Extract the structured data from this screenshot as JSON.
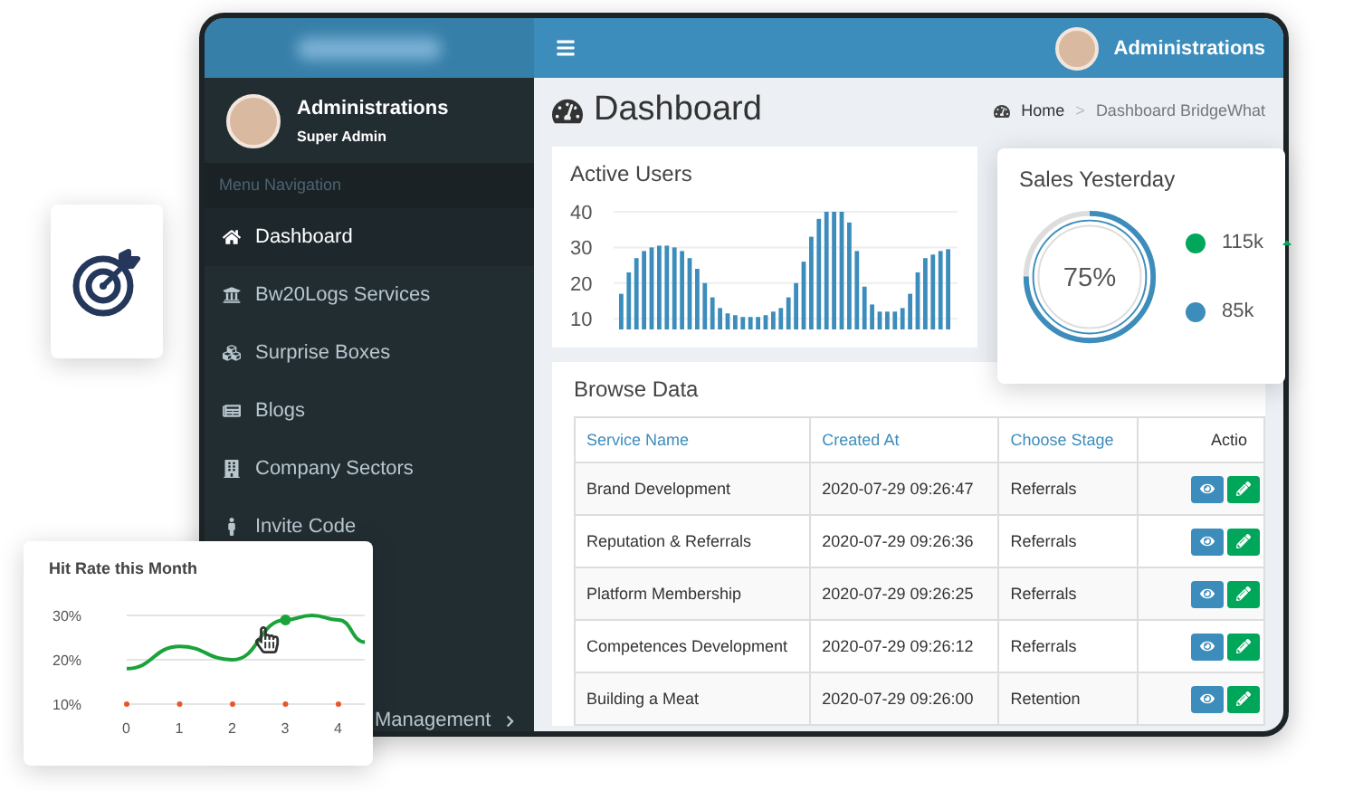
{
  "topbar": {
    "user_name": "Administrations"
  },
  "sidebar": {
    "user": {
      "name": "Administrations",
      "role": "Super Admin"
    },
    "header": "Menu Navigation",
    "items": [
      {
        "label": "Dashboard",
        "selected": true,
        "expandable": false
      },
      {
        "label": "Bw20Logs Services",
        "selected": false,
        "expandable": false
      },
      {
        "label": "Surprise Boxes",
        "selected": false,
        "expandable": false
      },
      {
        "label": "Blogs",
        "selected": false,
        "expandable": false
      },
      {
        "label": "Company Sectors",
        "selected": false,
        "expandable": false
      },
      {
        "label": "Invite Code",
        "selected": false,
        "expandable": false
      },
      {
        "label": "Management",
        "selected": false,
        "expandable": true
      }
    ]
  },
  "page": {
    "title": "Dashboard",
    "breadcrumb": [
      "Home",
      "Dashboard BridgeWhat"
    ],
    "breadcrumb_separator": ">"
  },
  "active_users": {
    "title": "Active Users",
    "chart_data": {
      "type": "bar",
      "grid": true,
      "ylim": [
        7,
        40
      ],
      "yticks": [
        10,
        20,
        30,
        40
      ],
      "values": [
        17,
        23,
        27,
        29,
        30,
        30.5,
        30.5,
        30,
        29,
        27,
        24,
        20,
        16,
        13,
        11.5,
        11,
        10.5,
        10.5,
        10.5,
        11,
        12,
        13,
        16,
        20,
        26,
        33,
        38,
        40,
        40,
        40,
        37,
        29,
        19,
        14,
        12,
        12,
        12,
        13,
        17,
        23,
        27,
        28,
        29,
        29.5
      ]
    }
  },
  "browse_data": {
    "title": "Browse Data",
    "columns": [
      "Service Name",
      "Created At",
      "Choose Stage",
      "Actio"
    ],
    "rows": [
      [
        "Brand Development",
        "2020-07-29 09:26:47",
        "Referrals"
      ],
      [
        "Reputation & Referrals",
        "2020-07-29 09:26:36",
        "Referrals"
      ],
      [
        "Platform Membership",
        "2020-07-29 09:26:25",
        "Referrals"
      ],
      [
        "Competences Development",
        "2020-07-29 09:26:12",
        "Referrals"
      ],
      [
        "Building a Meat",
        "2020-07-29 09:26:00",
        "Retention"
      ]
    ]
  },
  "sales_card": {
    "title": "Sales Yesterday",
    "percent": "75%",
    "level": 0.75,
    "legend": [
      {
        "value": "115k",
        "color": "#00a65a",
        "trend_up": true
      },
      {
        "value": "85k",
        "color": "#3c8dbc",
        "trend_up": false
      }
    ]
  },
  "hit_rate_card": {
    "title": "Hit Rate this Month",
    "chart_data": {
      "type": "line",
      "x": [
        0,
        1,
        2,
        3,
        3.5,
        4,
        4.5
      ],
      "xlim": [
        0,
        4.5
      ],
      "ylim": [
        10,
        30
      ],
      "xticks": [
        0,
        1,
        2,
        3,
        4
      ],
      "yticks": [
        {
          "value": 10,
          "label": "10%"
        },
        {
          "value": 20,
          "label": "20%"
        },
        {
          "value": 30,
          "label": "30%"
        }
      ],
      "series": [
        {
          "color": "#1aa33a",
          "values": [
            18,
            23,
            20,
            29,
            30,
            29,
            24
          ]
        },
        {
          "type": "scatter",
          "color": "#e8552a",
          "values": [
            10,
            10,
            10,
            10,
            null,
            10,
            null
          ]
        }
      ]
    }
  }
}
